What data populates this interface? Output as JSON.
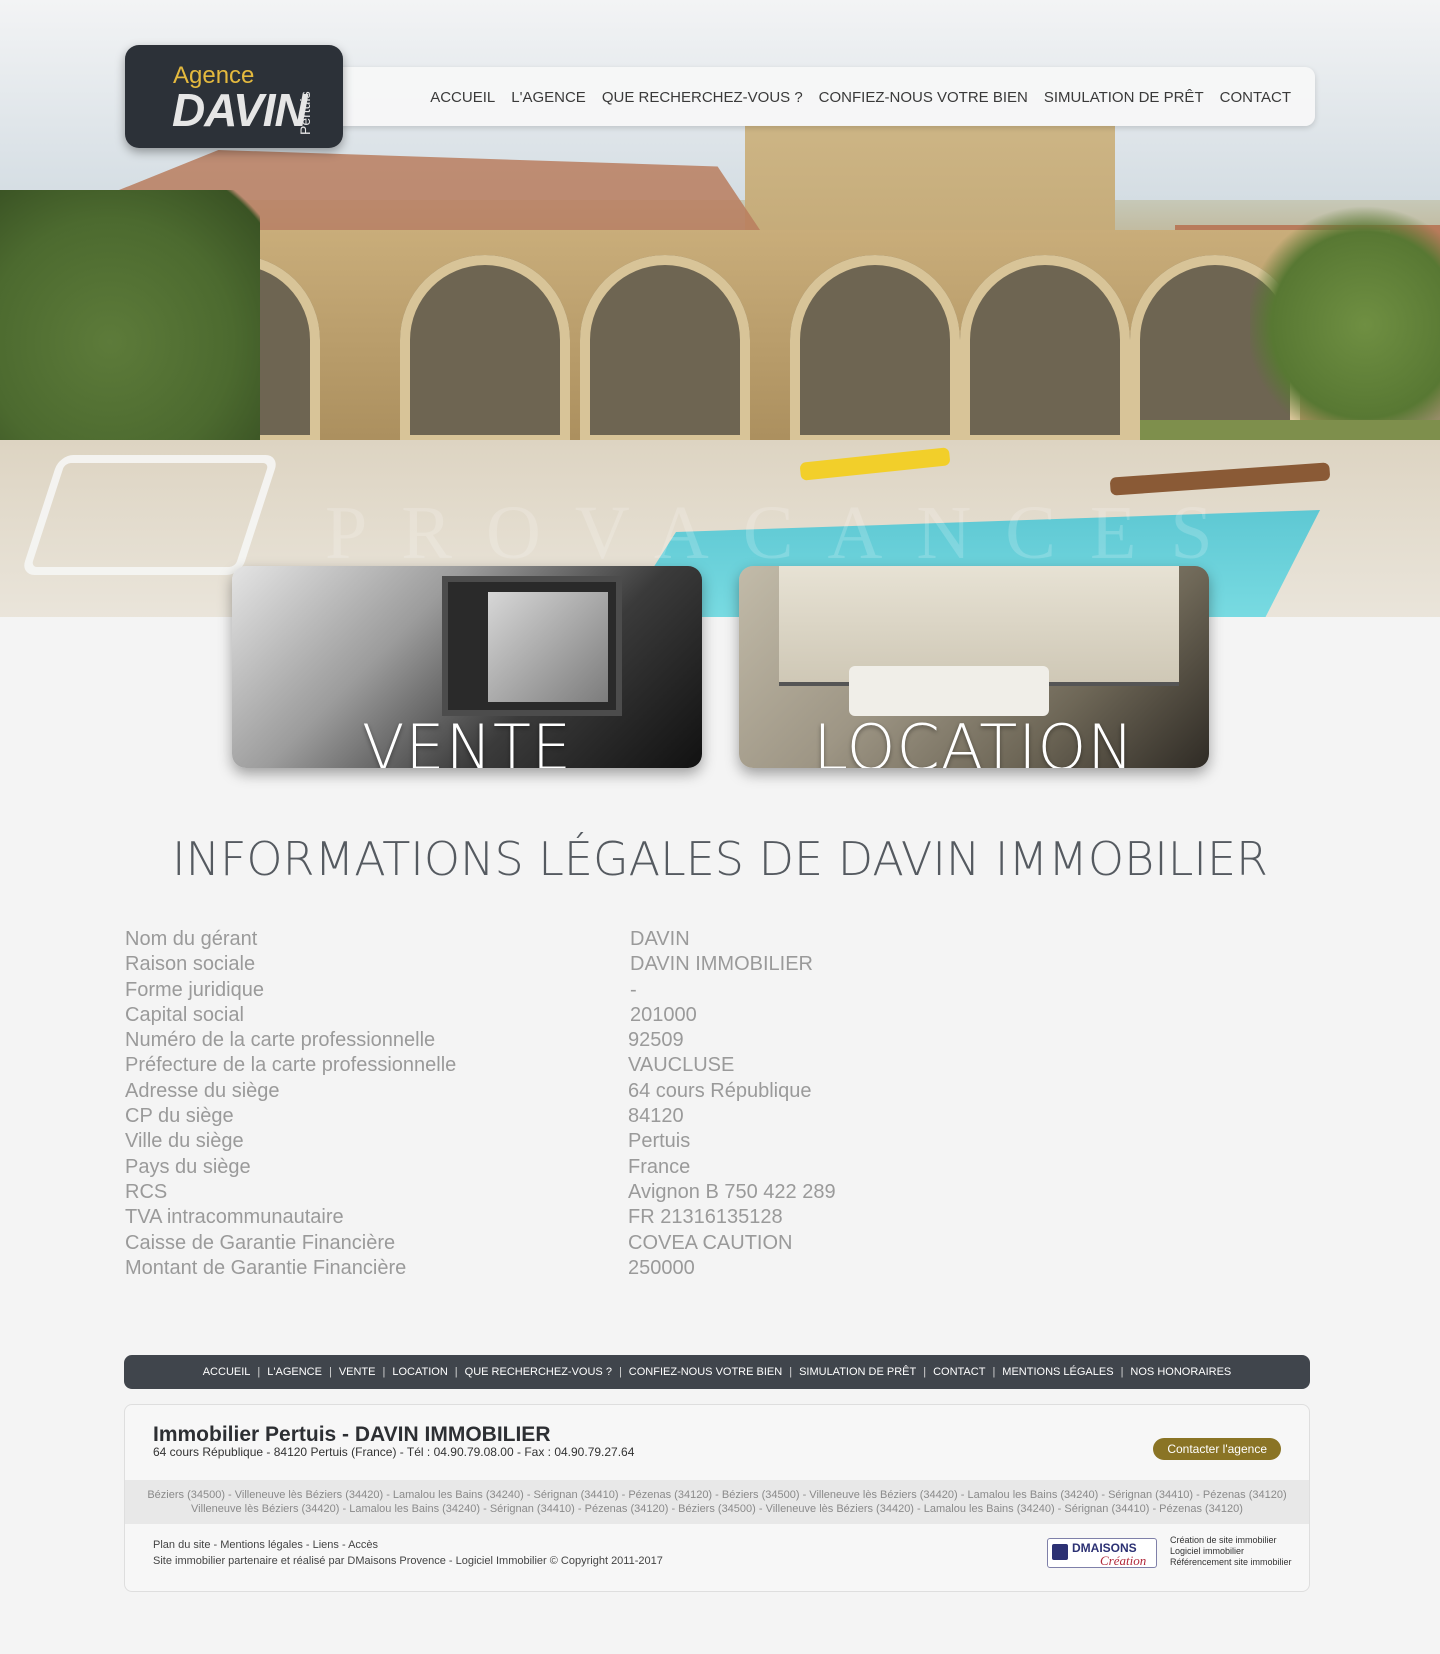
{
  "logo": {
    "line1": "Agence",
    "line2": "DAVIN",
    "line3": "Pertuis"
  },
  "nav": {
    "items": [
      "ACCUEIL",
      "L'AGENCE",
      "QUE RECHERCHEZ-VOUS ?",
      "CONFIEZ-NOUS VOTRE BIEN",
      "SIMULATION DE PRÊT",
      "CONTACT"
    ]
  },
  "hero": {
    "watermark": "PROVACANCES"
  },
  "tiles": {
    "vente": "VENTE",
    "location": "LOCATION"
  },
  "page_title": "INFORMATIONS LÉGALES DE DAVIN IMMOBILIER",
  "legal": [
    {
      "k": "Nom du gérant",
      "v": "DAVIN"
    },
    {
      "k": "Raison sociale",
      "v": "DAVIN IMMOBILIER"
    },
    {
      "k": "Forme juridique",
      "v": "-"
    },
    {
      "k": "Capital social",
      "v": "201000"
    },
    {
      "k": "Numéro de la carte professionnelle",
      "v": "92509"
    },
    {
      "k": "Préfecture de la carte professionnelle",
      "v": "VAUCLUSE"
    },
    {
      "k": "Adresse du siège",
      "v": "64 cours République"
    },
    {
      "k": "CP du siège",
      "v": "84120"
    },
    {
      "k": "Ville du siège",
      "v": "Pertuis"
    },
    {
      "k": "Pays du siège",
      "v": "France"
    },
    {
      "k": "RCS",
      "v": "Avignon B 750 422 289"
    },
    {
      "k": "TVA intracommunautaire",
      "v": "FR 21316135128"
    },
    {
      "k": "Caisse de Garantie Financière",
      "v": "COVEA CAUTION"
    },
    {
      "k": "Montant de Garantie Financière",
      "v": "250000"
    }
  ],
  "footer_nav": {
    "items": [
      "ACCUEIL",
      "L'AGENCE",
      "VENTE",
      "LOCATION",
      "QUE RECHERCHEZ-VOUS ?",
      "CONFIEZ-NOUS VOTRE BIEN",
      "SIMULATION DE PRÊT",
      "CONTACT",
      "MENTIONS LÉGALES",
      "NOS HONORAIRES"
    ],
    "separator": "|"
  },
  "footer": {
    "title": "Immobilier Pertuis - DAVIN IMMOBILIER",
    "address": "64 cours République - 84120 Pertuis (France) - Tél : 04.90.79.08.00 - Fax : 04.90.79.27.64",
    "contact_button": "Contacter l'agence",
    "cities_line1": "Béziers (34500) - Villeneuve lès Béziers (34420) - Lamalou les Bains (34240) - Sérignan (34410) - Pézenas (34120) - Béziers (34500) - Villeneuve lès Béziers (34420) - Lamalou les Bains (34240) - Sérignan (34410) - Pézenas (34120)",
    "cities_line2": "Villeneuve lès Béziers (34420) - Lamalou les Bains (34240) - Sérignan (34410) - Pézenas (34120) - Béziers (34500) - Villeneuve lès Béziers (34420) - Lamalou les Bains (34240) - Sérignan (34410) - Pézenas (34120)",
    "links": [
      "Plan du site",
      "Mentions légales",
      "Liens",
      "Accès"
    ],
    "credit": "Site immobilier partenaire et réalisé par DMaisons Provence - Logiciel Immobilier © Copyright 2011-2017",
    "partner_logo": {
      "name": "DMAISONS",
      "sub": "Création"
    },
    "partner_links": [
      "Création de site immobilier",
      "Logiciel immobilier",
      "Référencement site immobilier"
    ]
  },
  "colors": {
    "accent": "#8a7425",
    "dark": "#40454c",
    "logo_bg": "#2c3138",
    "logo_gold": "#e4b93e"
  }
}
